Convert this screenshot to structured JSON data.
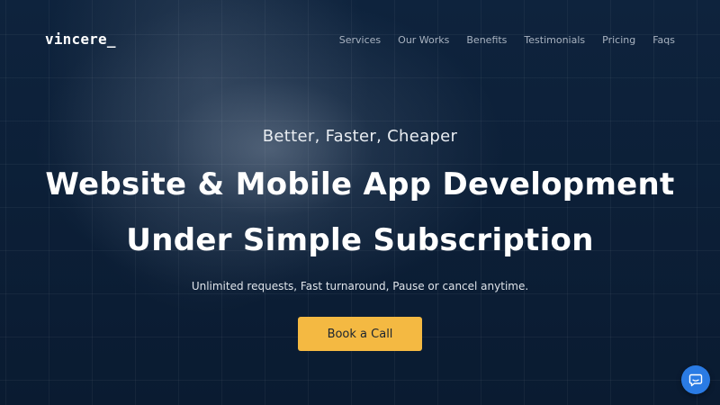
{
  "brand": {
    "logo": "vincere_"
  },
  "nav": {
    "items": [
      "Services",
      "Our Works",
      "Benefits",
      "Testimonials",
      "Pricing",
      "Faqs"
    ],
    "color": "#a9b3c1"
  },
  "hero": {
    "tagline": "Better, Faster, Cheaper",
    "headline_line1": "Website & Mobile App Development",
    "headline_line2": "Under Simple Subscription",
    "subtext": "Unlimited requests, Fast turnaround, Pause or cancel anytime.",
    "cta_label": "Book a Call",
    "cta_color": "#f4b942",
    "background_color": "#0c1f37"
  },
  "chat_widget": {
    "icon": "chat-bubble-icon",
    "color": "#2a7be4"
  }
}
